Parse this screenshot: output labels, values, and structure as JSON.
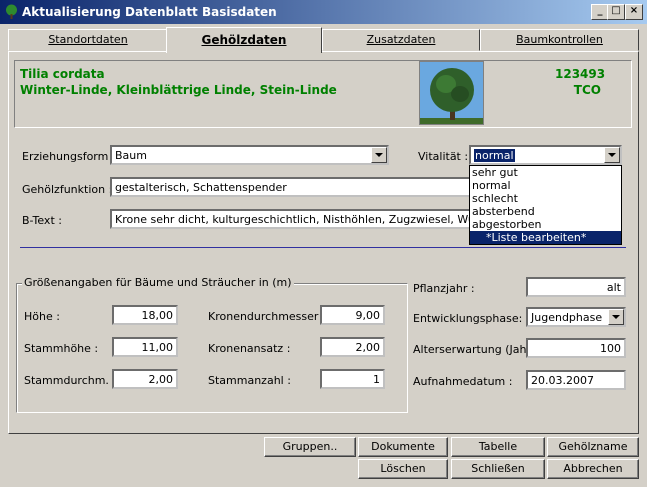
{
  "window": {
    "title": "Aktualisierung Datenblatt  Basisdaten",
    "min": "_",
    "max": "□",
    "close": "×"
  },
  "tabs": [
    "Standortdaten",
    "Gehölzdaten",
    "Zusatzdaten",
    "Baumkontrollen"
  ],
  "header": {
    "botanical_name": "Tilia cordata",
    "common_names": "Winter-Linde, Kleinblättrige Linde, Stein-Linde",
    "id_number": "123493",
    "code": "TCO"
  },
  "form": {
    "erziehungsform_label": "Erziehungsform :",
    "erziehungsform_value": "Baum",
    "vitalitaet_label": "Vitalität :",
    "vitalitaet_value": "normal",
    "vitalitaet_options": [
      "sehr gut",
      "normal",
      "schlecht",
      "absterbend",
      "abgestorben",
      "*Liste bearbeiten*"
    ],
    "gehoelzfunktion_label": "Gehölzfunktion :",
    "gehoelzfunktion_value": "gestalterisch, Schattenspender",
    "btext_label": "B-Text :",
    "btext_value": "Krone sehr dicht, kulturgeschichtlich, Nisthöhlen, Zugzwiesel, Wurzel über N"
  },
  "sizes": {
    "group_title": "Größenangaben für Bäume und Sträucher in (m)",
    "hoehe_label": "Höhe :",
    "hoehe": "18,00",
    "stammhoehe_label": "Stammhöhe :",
    "stammhoehe": "11,00",
    "stammdurchm_label": "Stammdurchm. :",
    "stammdurchm": "2,00",
    "kronendurchmesser_label": "Kronendurchmesser :",
    "kronendurchmesser": "9,00",
    "kronenansatz_label": "Kronenansatz :",
    "kronenansatz": "2,00",
    "stammanzahl_label": "Stammanzahl :",
    "stammanzahl": "1"
  },
  "right": {
    "pflanzjahr_label": "Pflanzjahr :",
    "pflanzjahr": "alt",
    "entwicklungsphase_label": "Entwicklungsphase:",
    "entwicklungsphase": "Jugendphase",
    "alterserwartung_label": "Alterserwartung (Jahre)",
    "alterserwartung": "100",
    "aufnahmedatum_label": "Aufnahmedatum :",
    "aufnahmedatum": "20.03.2007"
  },
  "buttons": {
    "gruppen": "Gruppen..",
    "dokumente": "Dokumente",
    "tabelle": "Tabelle",
    "gehoelzname": "Gehölzname",
    "loeschen": "Löschen",
    "schliessen": "Schließen",
    "abbrechen": "Abbrechen"
  }
}
